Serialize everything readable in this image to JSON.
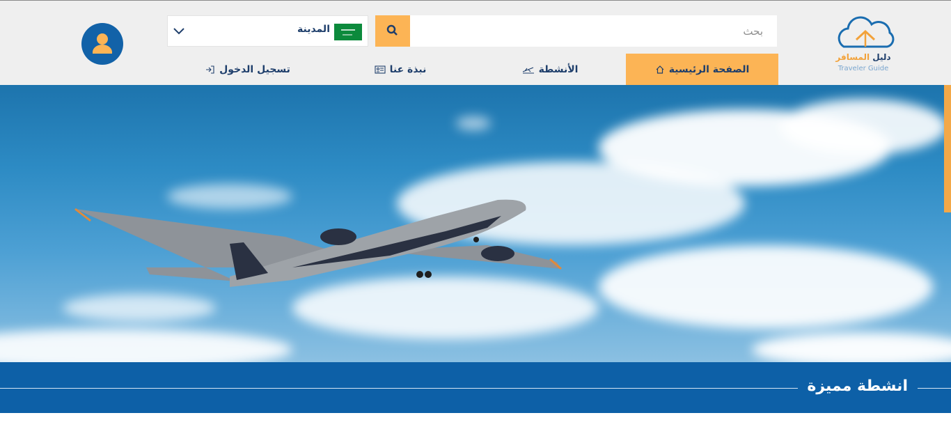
{
  "header": {
    "search_placeholder": "بحث",
    "city_label": "المدينة",
    "flag": "saudi-arabia-flag",
    "logo_ar_main": "دليل",
    "logo_ar_accent": "المسافر",
    "logo_en": "Traveler Guide"
  },
  "nav": {
    "home": "الصفحة الرئيسية",
    "activities": "الأنشطة",
    "about": "نبذة عنا",
    "login": "تسجيل الدخول"
  },
  "section": {
    "title": "انشطة مميزة"
  },
  "colors": {
    "accent": "#fcb455",
    "primary": "#0d60a7",
    "text_dark": "#1e3e6b"
  },
  "icons": [
    "user-icon",
    "chevron-down-icon",
    "search-icon",
    "home-icon",
    "plane-icon",
    "id-card-icon",
    "login-icon"
  ]
}
